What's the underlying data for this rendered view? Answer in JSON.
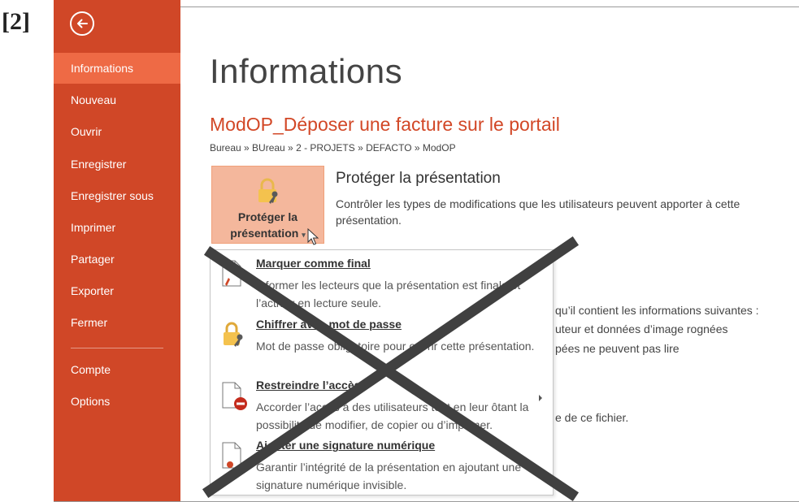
{
  "step_label": "[2]",
  "sidebar": {
    "items": [
      {
        "label": "Informations"
      },
      {
        "label": "Nouveau"
      },
      {
        "label": "Ouvrir"
      },
      {
        "label": "Enregistrer"
      },
      {
        "label": "Enregistrer sous"
      },
      {
        "label": "Imprimer"
      },
      {
        "label": "Partager"
      },
      {
        "label": "Exporter"
      },
      {
        "label": "Fermer"
      },
      {
        "label": "Compte"
      },
      {
        "label": "Options"
      }
    ],
    "active": "Informations",
    "color": "#d04727",
    "active_color": "#ee6a45"
  },
  "main": {
    "title": "Informations",
    "file_title": "ModOP_Déposer une facture sur le portail",
    "breadcrumb": "Bureau » BUreau » 2 - PROJETS » DEFACTO » ModOP",
    "protect": {
      "button_line1": "Protéger la",
      "button_line2": "présentation",
      "heading": "Protéger la présentation",
      "description": "Contrôler les types de modifications que les utilisateurs peuvent apporter à cette présentation."
    },
    "background_fragments": {
      "line1": "qu’il contient les informations suivantes :",
      "line2": "uteur et données d’image rognées",
      "line3": "pées ne peuvent pas lire",
      "line4": "e de ce fichier."
    }
  },
  "dropdown": {
    "items": [
      {
        "title": "Marquer comme final",
        "desc": "Informer les lecteurs que la présentation est finale et l’activer en lecture seule.",
        "icon": "document-mark-final-icon"
      },
      {
        "title": "Chiffrer avec mot de passe",
        "desc": "Mot de passe obligatoire pour ouvrir cette présentation.",
        "icon": "lock-key-icon"
      },
      {
        "title": "Restreindre l’accès",
        "desc": "Accorder l’accès à des utilisateurs tout en leur ôtant la possibilité de modifier, de copier ou d’imprimer.",
        "icon": "document-restrict-icon"
      },
      {
        "title": "Ajouter une signature numérique",
        "desc": "Garantir l’intégrité de la présentation en ajoutant une signature numérique invisible.",
        "icon": "document-signature-icon"
      }
    ]
  },
  "colors": {
    "accent": "#d24726",
    "button_bg": "#f4b79c",
    "cross": "#404040"
  }
}
